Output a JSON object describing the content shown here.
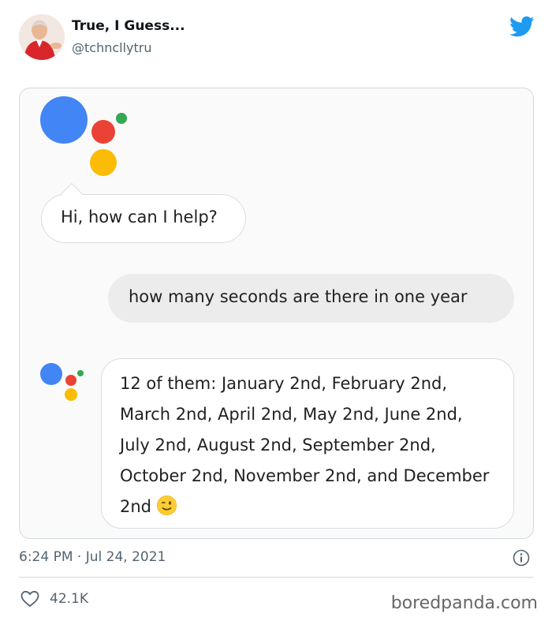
{
  "tweet": {
    "user_name": "True, I Guess...",
    "user_handle": "@tchncllytru",
    "timestamp": "6:24 PM · Jul 24, 2021",
    "likes": "42.1K"
  },
  "assistant": {
    "greeting": "Hi, how can I help?",
    "user_query": "how many seconds are there in one year",
    "answer": "12 of them: January 2nd, February 2nd, March 2nd, April 2nd, May 2nd, June 2nd, July 2nd, August 2nd, September 2nd, October 2nd, November 2nd, and December 2nd",
    "answer_emoji": "winking-face",
    "logo_colors": {
      "blue": "#4285f4",
      "red": "#ea4335",
      "yellow": "#fbbc05",
      "green": "#34a853"
    }
  },
  "watermark": "boredpanda.com",
  "colors": {
    "twitter_blue": "#1d9bf0",
    "secondary_text": "#536471",
    "border": "#cfd9de"
  }
}
